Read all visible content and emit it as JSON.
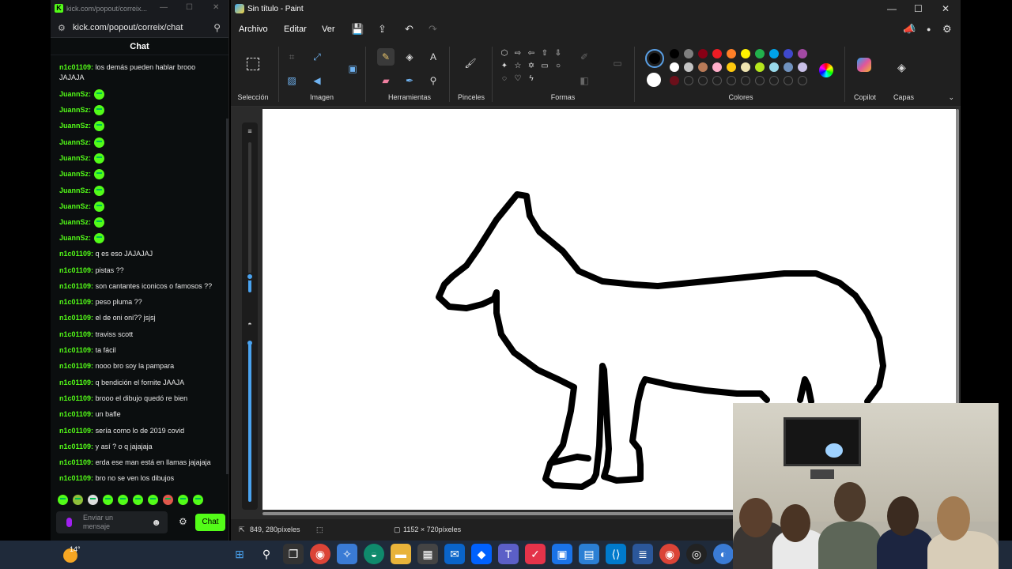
{
  "chat_window": {
    "title": "kick.com/popout/correix...",
    "url": "kick.com/popout/correix/chat",
    "header": "Chat",
    "messages": [
      {
        "user": "n1c01109:",
        "text": "los demás pueden hablar brooo JAJAJA",
        "emote": false
      },
      {
        "user": "JuannSz:",
        "text": "",
        "emote": true
      },
      {
        "user": "JuannSz:",
        "text": "",
        "emote": true
      },
      {
        "user": "JuannSz:",
        "text": "",
        "emote": true
      },
      {
        "user": "JuannSz:",
        "text": "",
        "emote": true
      },
      {
        "user": "JuannSz:",
        "text": "",
        "emote": true
      },
      {
        "user": "JuannSz:",
        "text": "",
        "emote": true
      },
      {
        "user": "JuannSz:",
        "text": "",
        "emote": true
      },
      {
        "user": "JuannSz:",
        "text": "",
        "emote": true
      },
      {
        "user": "JuannSz:",
        "text": "",
        "emote": true
      },
      {
        "user": "JuannSz:",
        "text": "",
        "emote": true
      },
      {
        "user": "n1c01109:",
        "text": "q es eso JAJAJAJ",
        "emote": false
      },
      {
        "user": "n1c01109:",
        "text": "pistas ??",
        "emote": false
      },
      {
        "user": "n1c01109:",
        "text": "son cantantes iconicos o famosos ??",
        "emote": false
      },
      {
        "user": "n1c01109:",
        "text": "peso pluma ??",
        "emote": false
      },
      {
        "user": "n1c01109:",
        "text": "el de oni oni?? jsjsj",
        "emote": false
      },
      {
        "user": "n1c01109:",
        "text": "traviss scott",
        "emote": false
      },
      {
        "user": "n1c01109:",
        "text": "ta fácil",
        "emote": false
      },
      {
        "user": "n1c01109:",
        "text": "nooo bro soy la pampara",
        "emote": false
      },
      {
        "user": "n1c01109:",
        "text": "q bendición el fornite JAAJA",
        "emote": false
      },
      {
        "user": "n1c01109:",
        "text": "brooo el dibujo quedó re bien",
        "emote": false
      },
      {
        "user": "n1c01109:",
        "text": "un bafle",
        "emote": false
      },
      {
        "user": "n1c01109:",
        "text": "sería como lo de 2019 covid",
        "emote": false
      },
      {
        "user": "n1c01109:",
        "text": "y así ? o q jajajaja",
        "emote": false
      },
      {
        "user": "n1c01109:",
        "text": "erda ese man está en llamas jajajaja",
        "emote": false
      },
      {
        "user": "n1c01109:",
        "text": "bro no se ven los dibujos",
        "emote": false
      }
    ],
    "input_placeholder": "Enviar un mensaje",
    "send_label": "Chat"
  },
  "paint": {
    "title": "Sin título - Paint",
    "menu": [
      "Archivo",
      "Editar",
      "Ver"
    ],
    "groups": {
      "selection": "Selección",
      "image": "Imagen",
      "tools": "Herramientas",
      "brushes": "Pinceles",
      "shapes": "Formas",
      "colors": "Colores",
      "copilot": "Copilot",
      "layers": "Capas"
    },
    "palette_row1": [
      "#000000",
      "#7f7f7f",
      "#880015",
      "#ed1c24",
      "#ff7f27",
      "#fff200",
      "#22b14c",
      "#00a2e8",
      "#3f48cc",
      "#a349a4"
    ],
    "palette_row2": [
      "#ffffff",
      "#c3c3c3",
      "#b97a57",
      "#ffaec9",
      "#ffc90e",
      "#efe4b0",
      "#b5e61d",
      "#99d9ea",
      "#7092be",
      "#c8bfe7"
    ],
    "palette_row3": [
      "#6b0f1a"
    ],
    "status": {
      "cursor": "849, 280píxeles",
      "size": "1152 × 720píxeles"
    }
  },
  "taskbar": {
    "temperature": "14°"
  }
}
